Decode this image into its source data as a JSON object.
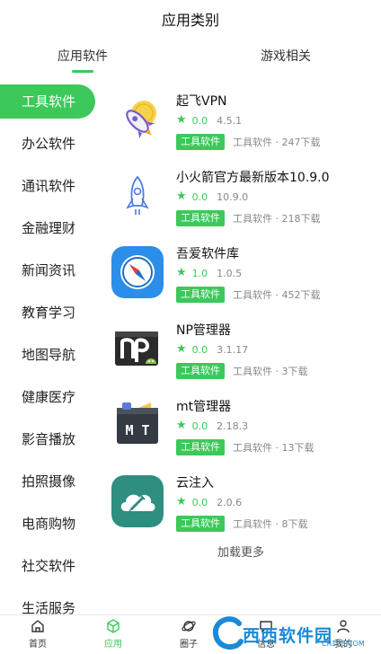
{
  "header": {
    "title": "应用类别"
  },
  "tabs": [
    {
      "label": "应用软件",
      "active": true
    },
    {
      "label": "游戏相关",
      "active": false
    }
  ],
  "sidebar": {
    "items": [
      {
        "label": "工具软件",
        "active": true
      },
      {
        "label": "办公软件"
      },
      {
        "label": "通讯软件"
      },
      {
        "label": "金融理财"
      },
      {
        "label": "新闻资讯"
      },
      {
        "label": "教育学习"
      },
      {
        "label": "地图导航"
      },
      {
        "label": "健康医疗"
      },
      {
        "label": "影音播放"
      },
      {
        "label": "拍照摄像"
      },
      {
        "label": "电商购物"
      },
      {
        "label": "社交软件"
      },
      {
        "label": "生活服务"
      }
    ]
  },
  "apps": [
    {
      "name": "起飞VPN",
      "score": "0.0",
      "version": "4.5.1",
      "category": "工具软件",
      "info": "工具软件 · 247下载",
      "icon": "rocket-coin-icon"
    },
    {
      "name": "小火箭官方最新版本10.9.0",
      "score": "0.0",
      "version": "10.9.0",
      "category": "工具软件",
      "info": "工具软件 · 218下载",
      "icon": "rocket-outline-icon"
    },
    {
      "name": "吾爱软件库",
      "score": "1.0",
      "version": "1.0.5",
      "category": "工具软件",
      "info": "工具软件 · 452下载",
      "icon": "compass-icon"
    },
    {
      "name": "NP管理器",
      "score": "0.0",
      "version": "3.1.17",
      "category": "工具软件",
      "info": "工具软件 · 3下载",
      "icon": "np-manager-icon"
    },
    {
      "name": "mt管理器",
      "score": "0.0",
      "version": "2.18.3",
      "category": "工具软件",
      "info": "工具软件 · 13下载",
      "icon": "mt-manager-icon"
    },
    {
      "name": "云注入",
      "score": "0.0",
      "version": "2.0.6",
      "category": "工具软件",
      "info": "工具软件 · 8下载",
      "icon": "cloud-syringe-icon"
    }
  ],
  "load_more": "加载更多",
  "bottom_nav": [
    {
      "label": "首页",
      "icon": "home-icon"
    },
    {
      "label": "应用",
      "icon": "cube-icon",
      "active": true
    },
    {
      "label": "圈子",
      "icon": "planet-icon"
    },
    {
      "label": "信息",
      "icon": "message-icon"
    },
    {
      "label": "我的",
      "icon": "user-icon"
    }
  ],
  "watermark": {
    "main": "西西软件园",
    "sub": "CR173.COM"
  },
  "colors": {
    "accent": "#3dc85a",
    "text": "#222222",
    "muted": "#888888"
  }
}
